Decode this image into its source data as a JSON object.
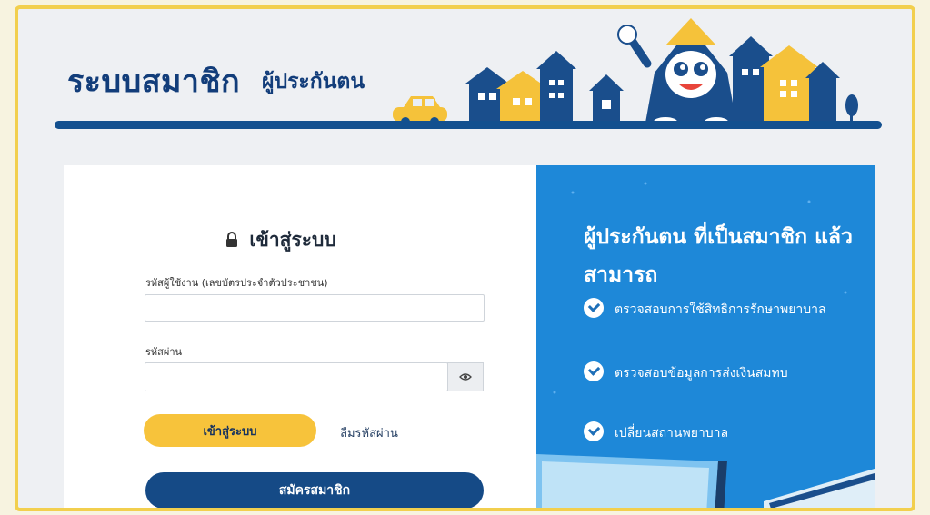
{
  "header": {
    "title": "ระบบสมาชิก",
    "subtitle": "ผู้ประกันตน"
  },
  "login": {
    "title": "เข้าสู่ระบบ",
    "username_label": "รหัสผู้ใช้งาน (เลขบัตรประจำตัวประชาชน)",
    "username_value": "",
    "password_label": "รหัสผ่าน",
    "password_value": "",
    "login_button": "เข้าสู่ระบบ",
    "forgot_link": "ลืมรหัสผ่าน",
    "register_button": "สมัครสมาชิก"
  },
  "info": {
    "title": "ผู้ประกันตน ที่เป็นสมาชิก แล้วสามารถ",
    "benefits": [
      "ตรวจสอบการใช้สิทธิการรักษาพยาบาล",
      "ตรวจสอบข้อมูลการส่งเงินสมทบ",
      "เปลี่ยนสถานพยาบาล"
    ]
  },
  "colors": {
    "primary_navy": "#123d7a",
    "accent_yellow": "#f7c33b",
    "panel_blue": "#1e88d8",
    "frame_yellow": "#f2cf4e"
  },
  "icons": [
    "lock-icon",
    "eye-icon",
    "check-icon",
    "mascot-illustration",
    "city-skyline-illustration",
    "car-illustration",
    "laptop-illustration"
  ]
}
